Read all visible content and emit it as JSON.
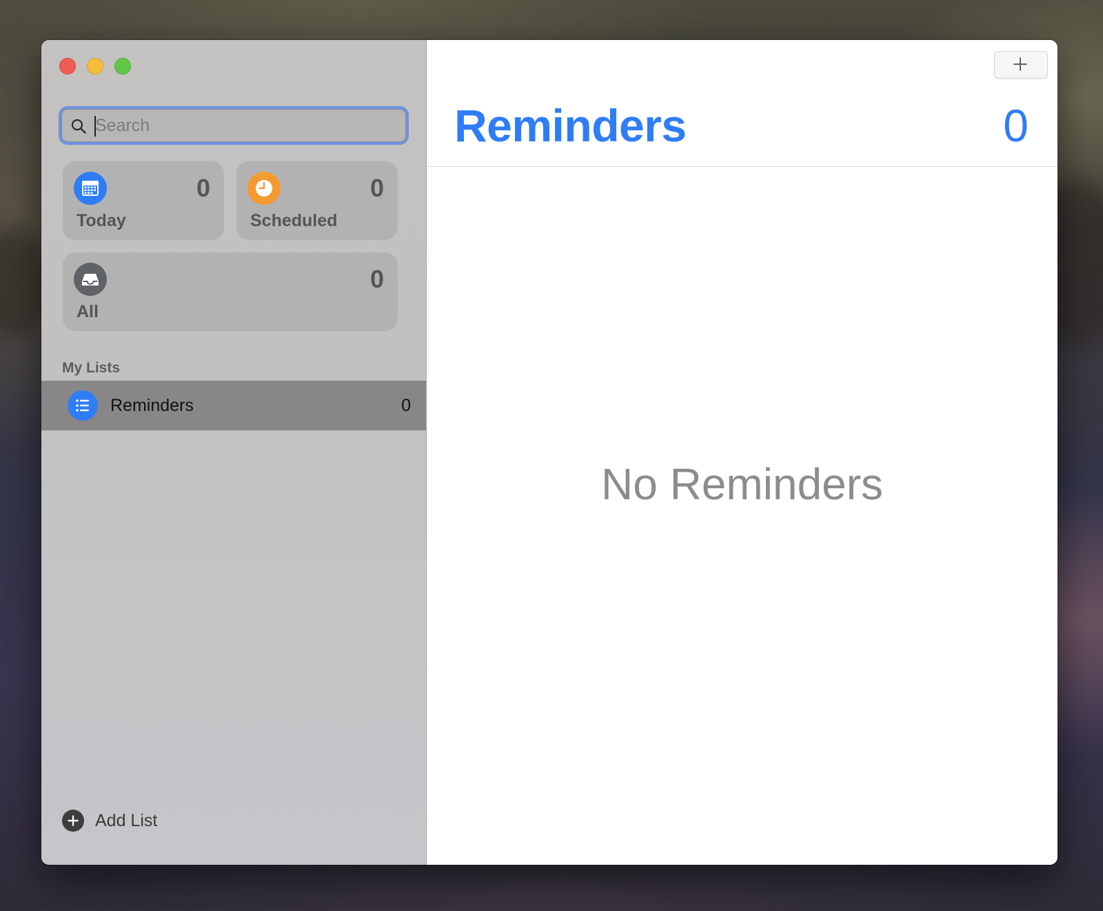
{
  "window": {
    "traffic_lights": [
      "close",
      "minimize",
      "zoom"
    ]
  },
  "sidebar": {
    "search": {
      "placeholder": "Search",
      "value": ""
    },
    "smart_lists": {
      "today": {
        "label": "Today",
        "count": "0",
        "icon": "calendar-icon",
        "color": "#2f7df6"
      },
      "scheduled": {
        "label": "Scheduled",
        "count": "0",
        "icon": "clock-icon",
        "color": "#f59a2f"
      },
      "all": {
        "label": "All",
        "count": "0",
        "icon": "tray-icon",
        "color": "#5f6266"
      }
    },
    "section_header": "My Lists",
    "lists": [
      {
        "name": "Reminders",
        "count": "0",
        "icon": "list-bullet-icon",
        "color": "#2f7df6",
        "selected": true
      }
    ],
    "add_list_label": "Add List"
  },
  "main": {
    "title": "Reminders",
    "count": "0",
    "empty_state": "No Reminders",
    "accent_color": "#2f7df6"
  }
}
